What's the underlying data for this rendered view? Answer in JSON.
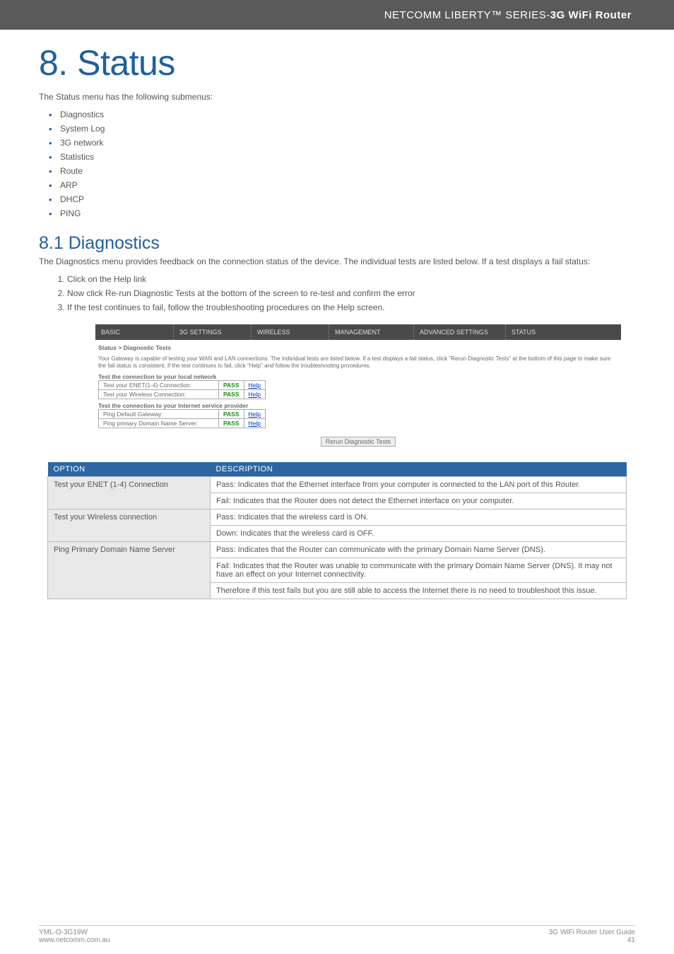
{
  "header": {
    "brand_thin": "NETCOMM LIBERTY™ SERIES",
    "brand_sep": " - ",
    "brand_bold": "3G WiFi Router"
  },
  "chapter_title": "8. Status",
  "intro_line": "The Status menu has the following submenus:",
  "submenus": [
    "Diagnostics",
    "System Log",
    "3G network",
    "Statistics",
    "Route",
    "ARP",
    "DHCP",
    "PING"
  ],
  "section_title": "8.1 Diagnostics",
  "section_intro": "The Diagnostics menu provides feedback on the connection status of the device. The individual tests are listed below. If a test displays a fail status:",
  "steps": [
    "Click on the Help link",
    "Now click Re-run Diagnostic Tests at the bottom of the screen to re-test and confirm the error",
    "If the test continues to fail, follow the troubleshooting procedures on the Help screen."
  ],
  "embed": {
    "nav": [
      "BASIC",
      "3G SETTINGS",
      "WIRELESS",
      "MANAGEMENT",
      "ADVANCED SETTINGS",
      "STATUS"
    ],
    "crumb": "Status > Diagnostic Tests",
    "note": "Your Gateway is capable of testing your WAN and LAN connections. The individual tests are listed below. If a test displays a fail status, click \"Rerun Diagnostic Tests\" at the bottom of this page to make sure the fail status is consistent. If the test continues to fail, click \"Help\" and follow the troubleshooting procedures.",
    "group1_head": "Test the connection to your local network",
    "group1": [
      {
        "label": "Test your ENET(1-4) Connection:",
        "status": "PASS",
        "help": "Help"
      },
      {
        "label": "Test your Wireless Connection:",
        "status": "PASS",
        "help": "Help"
      }
    ],
    "group2_head": "Test the connection to your Internet service provider",
    "group2": [
      {
        "label": "Ping Default Gateway:",
        "status": "PASS",
        "help": "Help"
      },
      {
        "label": "Ping primary Domain Name Server:",
        "status": "PASS",
        "help": "Help"
      }
    ],
    "rerun_label": "Rerun Diagnostic Tests"
  },
  "opt_table": {
    "head_option": "OPTION",
    "head_desc": "DESCRIPTION",
    "rows": [
      {
        "option": "Test your ENET (1-4) Connection",
        "descs": [
          "Pass: Indicates that the Ethernet interface from your computer is connected to the LAN port of this Router.",
          "Fail: Indicates  that the Router does not detect the Ethernet interface on your computer."
        ]
      },
      {
        "option": "Test your Wireless connection",
        "descs": [
          "Pass: Indicates that the wireless card is ON.",
          "Down: Indicates that the wireless card is OFF."
        ]
      },
      {
        "option": "Ping Primary Domain Name Server",
        "descs": [
          "Pass: Indicates that the Router can communicate with the primary Domain Name Server (DNS).",
          "Fail: Indicates that the Router was unable to communicate with the primary Domain Name Server (DNS). It may not have an effect on your Internet connectivity.",
          "Therefore if this test fails but you are still able to access the Internet there is no need to troubleshoot this issue."
        ]
      }
    ]
  },
  "footer": {
    "left_line1": "YML-O-3G19W",
    "left_line2": "www.netcomm.com.au",
    "right_line1": "3G WiFi Router User Guide",
    "right_line2": "41"
  }
}
